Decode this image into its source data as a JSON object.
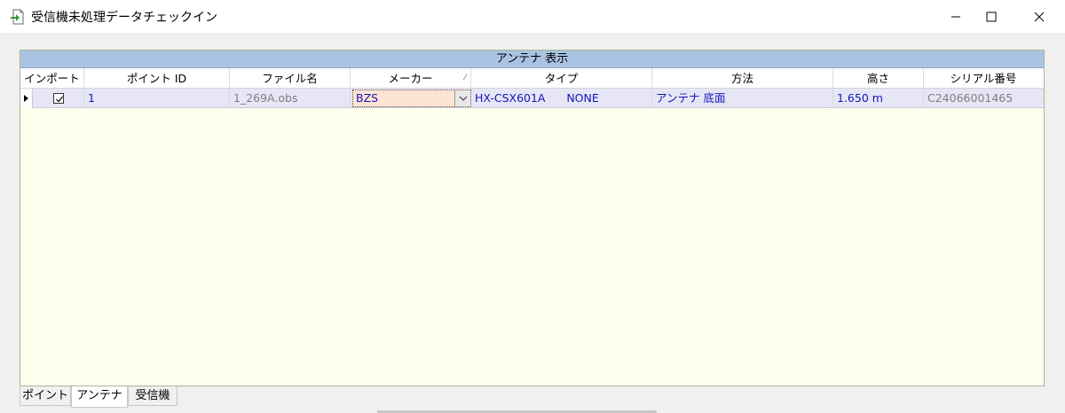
{
  "window": {
    "title": "受信機未処理データチェックイン"
  },
  "panel": {
    "group_header": "アンテナ 表示",
    "columns": [
      "インポート",
      "ポイント ID",
      "ファイル名",
      "メーカー",
      "タイプ",
      "方法",
      "高さ",
      "シリアル番号"
    ],
    "rows": [
      {
        "import_checked": true,
        "point_id": "1",
        "file_name": "1_269A.obs",
        "maker": "BZS",
        "type": "HX-CSX601A      NONE",
        "method": "アンテナ 底面",
        "height": "1.650 m",
        "serial": "C24066001465"
      }
    ]
  },
  "tabs": [
    "ポイント",
    "アンテナ",
    "受信機"
  ],
  "active_tab": "アンテナ",
  "colors": {
    "panel_bg": "#fffff0",
    "group_header_bg": "#a9c3e3",
    "row_bg": "#e6e6f6",
    "value_text": "#1515b8",
    "combo_bg": "#fde5d3"
  },
  "icons": {
    "app": "checkin-document-icon",
    "minimize": "minimize-icon",
    "maximize": "maximize-icon",
    "close": "close-icon",
    "checkbox": "checkmark-icon",
    "dropdown": "chevron-down-icon",
    "row_indicator": "row-pointer-icon"
  }
}
